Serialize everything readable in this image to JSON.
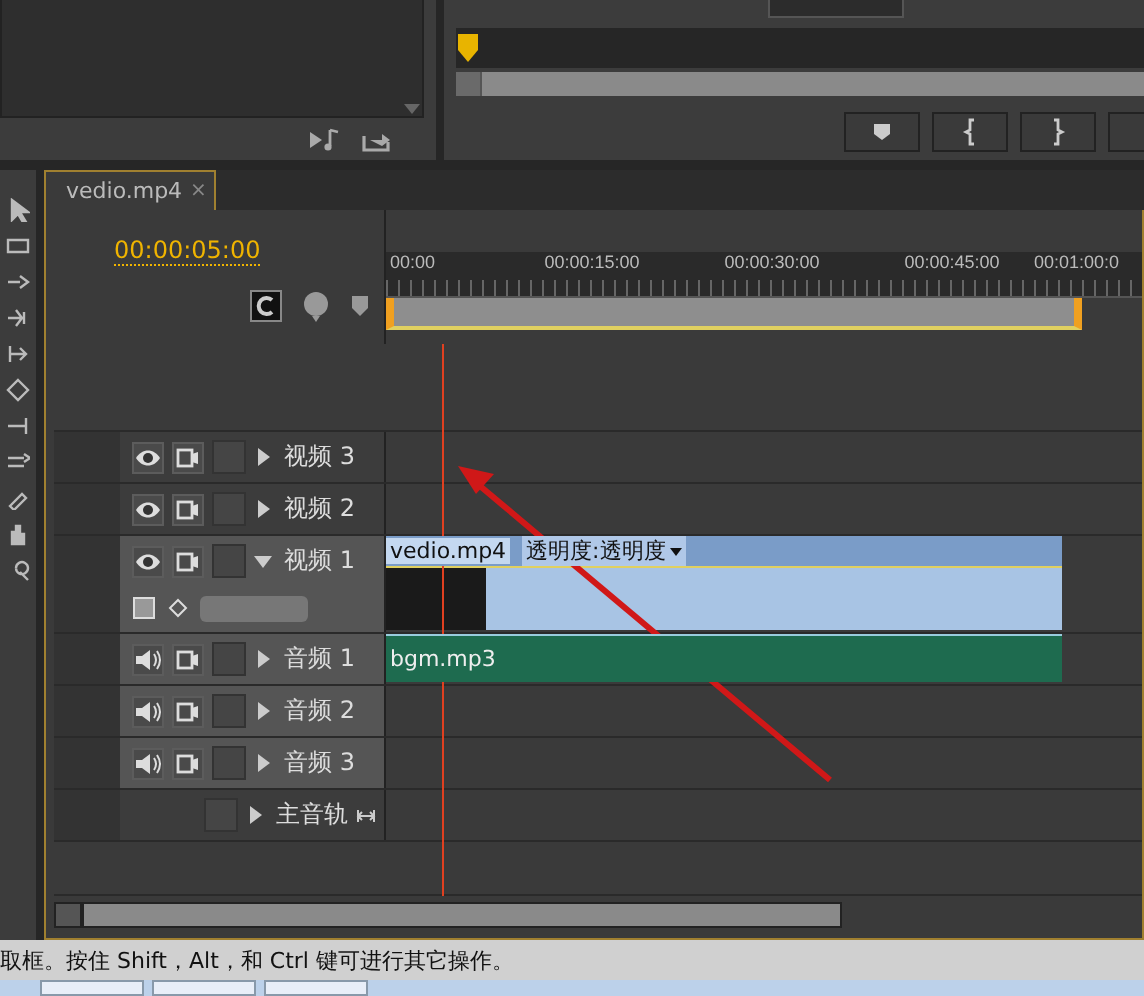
{
  "timeline": {
    "tab": {
      "label": "vedio.mp4",
      "close": "×",
      "selected": true
    },
    "timecode": "00:00:05:00",
    "ruler_labels": [
      "00:00",
      "00:00:15:00",
      "00:00:30:00",
      "00:00:45:00",
      "00:01:00:0"
    ],
    "tracks": [
      {
        "kind": "video",
        "name": "视频 3",
        "expanded": false,
        "targeted": false
      },
      {
        "kind": "video",
        "name": "视频 2",
        "expanded": false,
        "targeted": false
      },
      {
        "kind": "video",
        "name": "视频 1",
        "expanded": true,
        "targeted": true,
        "clip": {
          "name": "vedio.mp4",
          "effect": "透明度:透明度"
        }
      },
      {
        "kind": "audio",
        "name": "音频 1",
        "expanded": false,
        "targeted": true,
        "clip": {
          "name": "bgm.mp3"
        }
      },
      {
        "kind": "audio",
        "name": "音频 2",
        "expanded": false,
        "targeted": true
      },
      {
        "kind": "audio",
        "name": "音频 3",
        "expanded": false,
        "targeted": true
      },
      {
        "kind": "master",
        "name": "主音轨",
        "expanded": false,
        "targeted": false
      }
    ]
  },
  "status_bar": "取框。按住 Shift，Alt，和 Ctrl 键可进行其它操作。"
}
